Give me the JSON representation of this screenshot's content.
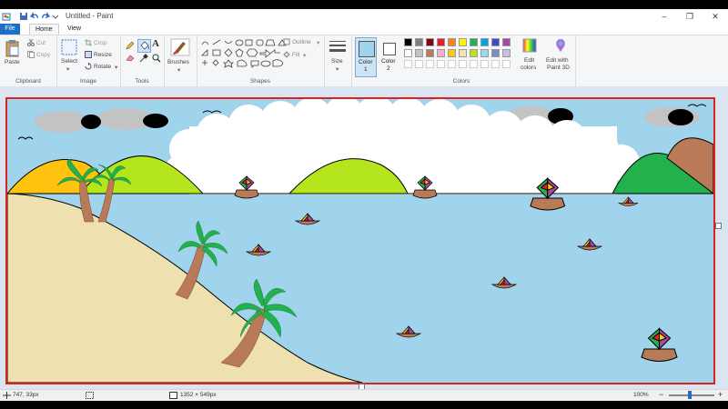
{
  "window": {
    "title": "Untitled - Paint",
    "controls": {
      "minimize": "–",
      "maximize": "❐",
      "close": "✕"
    }
  },
  "tabs": {
    "file": "File",
    "home": "Home",
    "view": "View"
  },
  "ribbon": {
    "clipboard": {
      "paste": "Paste",
      "cut": "Cut",
      "copy": "Copy",
      "label": "Clipboard"
    },
    "image": {
      "select": "Select",
      "crop": "Crop",
      "resize": "Resize",
      "rotate": "Rotate",
      "label": "Image"
    },
    "tools": {
      "label": "Tools",
      "text_glyph": "A"
    },
    "brushes": {
      "label": "Brushes"
    },
    "shapes": {
      "outline": "Outline",
      "fill": "Fill",
      "label": "Shapes"
    },
    "size": {
      "label": "Size"
    },
    "color1": {
      "line1": "Color",
      "line2": "1"
    },
    "color2": {
      "line1": "Color",
      "line2": "2"
    },
    "colors": {
      "label": "Colors",
      "edit": {
        "line1": "Edit",
        "line2": "colors"
      },
      "paint3d": {
        "line1": "Edit with",
        "line2": "Paint 3D"
      },
      "palette_row1": [
        "#000000",
        "#7f7f7f",
        "#880015",
        "#ed1c24",
        "#ff7f27",
        "#fff200",
        "#22b14c",
        "#00a2e8",
        "#3f48cc",
        "#a349a4"
      ],
      "palette_row2": [
        "#ffffff",
        "#c3c3c3",
        "#b97a57",
        "#ffaec9",
        "#ffc90e",
        "#efe4b0",
        "#b5e61d",
        "#99d9ea",
        "#7092be",
        "#c8bfe7"
      ],
      "color1_value": "#9fd4ec",
      "color2_value": "#ffffff"
    }
  },
  "status": {
    "cursor_pos": "747, 33px",
    "canvas_size": "1352 × 549px",
    "zoom": "100%",
    "zoom_minus": "−",
    "zoom_plus": "+"
  }
}
